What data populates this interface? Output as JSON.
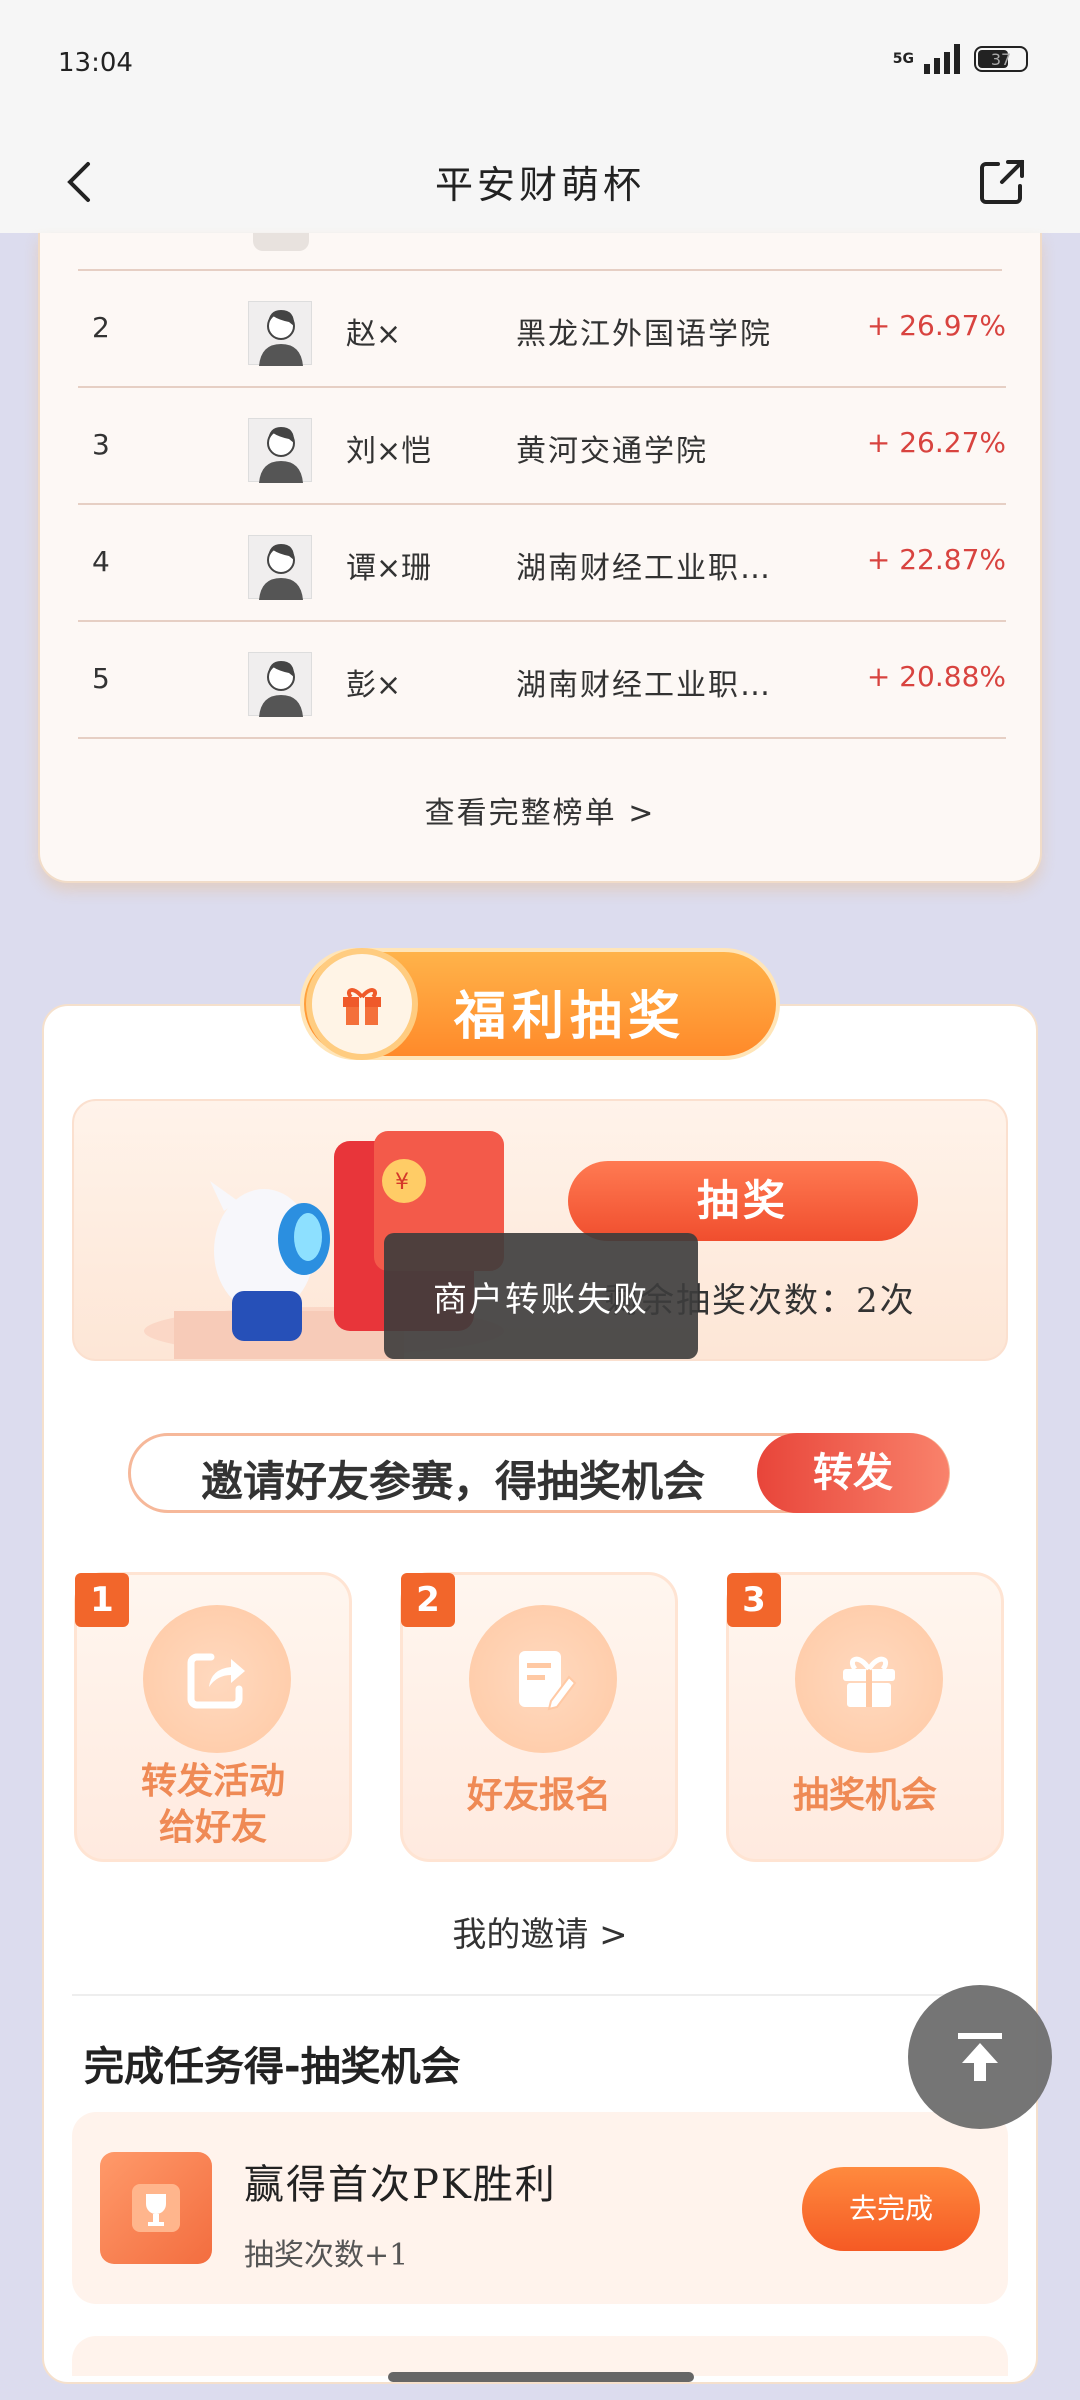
{
  "status_bar": {
    "time": "13:04",
    "network": "5G",
    "battery": "37"
  },
  "header": {
    "title": "平安财萌杯"
  },
  "ranking": {
    "rows": [
      {
        "rank": "2",
        "name": "赵×",
        "school": "黑龙江外国语学院",
        "change": "+ 26.97%"
      },
      {
        "rank": "3",
        "name": "刘×恺",
        "school": "黄河交通学院",
        "change": "+ 26.27%"
      },
      {
        "rank": "4",
        "name": "谭×珊",
        "school": "湖南财经工业职…",
        "change": "+ 22.87%"
      },
      {
        "rank": "5",
        "name": "彭×",
        "school": "湖南财经工业职…",
        "change": "+ 20.88%"
      }
    ],
    "view_full": "查看完整榜单 >"
  },
  "lottery": {
    "title": "福利抽奖",
    "draw_button": "抽奖",
    "remaining": "剩余抽奖次数：2次",
    "toast": "商户转账失败",
    "invite_text": "邀请好友参赛，得抽奖机会",
    "invite_button": "转发",
    "steps": [
      {
        "num": "1",
        "label_line1": "转发活动",
        "label_line2": "给好友"
      },
      {
        "num": "2",
        "label_line1": "好友报名",
        "label_line2": ""
      },
      {
        "num": "3",
        "label_line1": "抽奖机会",
        "label_line2": ""
      }
    ],
    "my_invite": "我的邀请 >"
  },
  "tasks": {
    "title": "完成任务得-抽奖机会",
    "items": [
      {
        "name": "赢得首次PK胜利",
        "reward": "抽奖次数+1",
        "button": "去完成"
      }
    ]
  },
  "colors": {
    "accent": "#f55a24",
    "up": "#d8433f",
    "page_bg": "#dcdcee"
  }
}
